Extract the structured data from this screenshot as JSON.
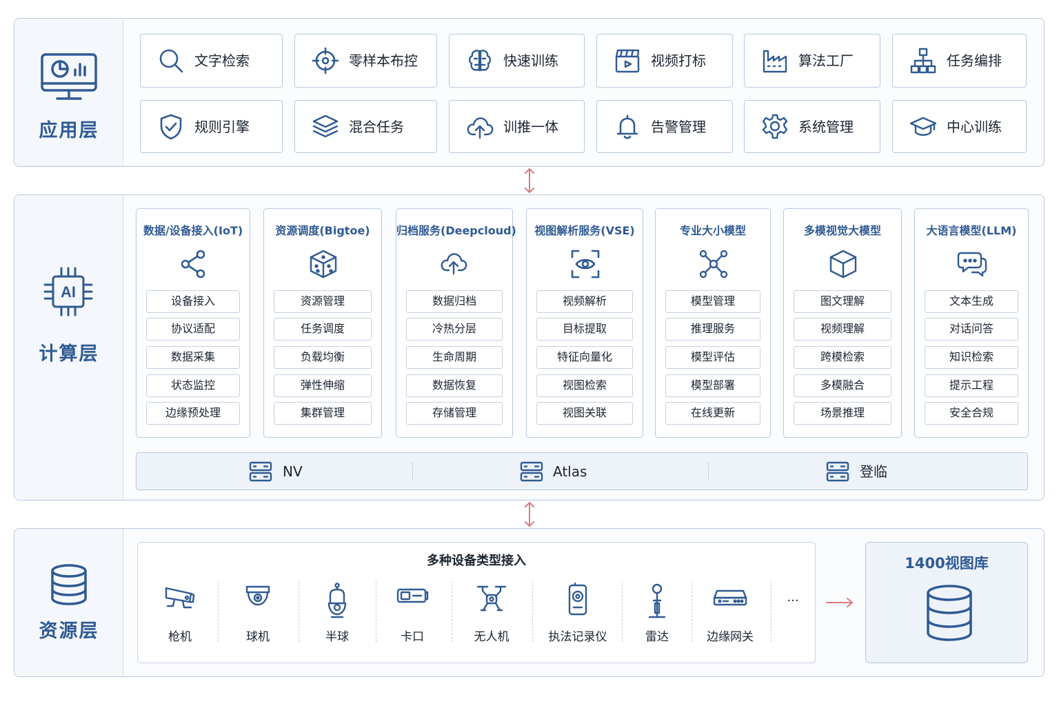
{
  "colors": {
    "accent": "#2f5a93",
    "border": "#b9c8dc",
    "arrow": "#d77a80"
  },
  "app_layer": {
    "title": "应用层",
    "icon": "monitor-chart-icon",
    "cards": [
      {
        "label": "文字检索",
        "icon": "search-icon"
      },
      {
        "label": "零样本布控",
        "icon": "crosshair-icon"
      },
      {
        "label": "快速训练",
        "icon": "brain-icon"
      },
      {
        "label": "视频打标",
        "icon": "clapperboard-icon"
      },
      {
        "label": "算法工厂",
        "icon": "factory-icon"
      },
      {
        "label": "任务编排",
        "icon": "hierarchy-icon"
      },
      {
        "label": "规则引擎",
        "icon": "shield-check-icon"
      },
      {
        "label": "混合任务",
        "icon": "layers-icon"
      },
      {
        "label": "训推一体",
        "icon": "cloud-upload-icon"
      },
      {
        "label": "告警管理",
        "icon": "bell-icon"
      },
      {
        "label": "系统管理",
        "icon": "gear-icon"
      },
      {
        "label": "中心训练",
        "icon": "graduation-cap-icon"
      }
    ]
  },
  "compute_layer": {
    "title": "计算层",
    "icon_text": "AI",
    "columns": [
      {
        "title": "数据/设备接入(IoT)",
        "icon": "share-icon",
        "items": [
          "设备接入",
          "协议适配",
          "数据采集",
          "状态监控",
          "边缘预处理"
        ]
      },
      {
        "title": "资源调度(Bigtoe)",
        "icon": "cube-dots-icon",
        "items": [
          "资源管理",
          "任务调度",
          "负载均衡",
          "弹性伸缩",
          "集群管理"
        ]
      },
      {
        "title": "归档服务(Deepcloud)",
        "icon": "cloud-upload-icon",
        "items": [
          "数据归档",
          "冷热分层",
          "生命周期",
          "数据恢复",
          "存储管理"
        ]
      },
      {
        "title": "视图解析服务(VSE)",
        "icon": "eye-scan-icon",
        "items": [
          "视频解析",
          "目标提取",
          "特征向量化",
          "视图检索",
          "视图关联"
        ]
      },
      {
        "title": "专业大小模型",
        "icon": "network-nodes-icon",
        "items": [
          "模型管理",
          "推理服务",
          "模型评估",
          "模型部署",
          "在线更新"
        ]
      },
      {
        "title": "多模视觉大模型",
        "icon": "cube-icon",
        "items": [
          "图文理解",
          "视频理解",
          "跨模检索",
          "多模融合",
          "场景推理"
        ]
      },
      {
        "title": "大语言模型(LLM)",
        "icon": "chat-bubbles-icon",
        "items": [
          "文本生成",
          "对话问答",
          "知识检索",
          "提示工程",
          "安全合规"
        ]
      }
    ],
    "hardware": [
      {
        "label": "NV",
        "icon": "server-icon"
      },
      {
        "label": "Atlas",
        "icon": "server-icon"
      },
      {
        "label": "登临",
        "icon": "server-icon"
      }
    ]
  },
  "resource_layer": {
    "title": "资源层",
    "icon": "database-icon",
    "devices_title": "多种设备类型接入",
    "devices": [
      {
        "label": "枪机",
        "icon": "bullet-camera-icon"
      },
      {
        "label": "球机",
        "icon": "dome-camera-icon"
      },
      {
        "label": "半球",
        "icon": "ptz-camera-icon"
      },
      {
        "label": "卡口",
        "icon": "checkpoint-camera-icon"
      },
      {
        "label": "无人机",
        "icon": "drone-icon"
      },
      {
        "label": "执法记录仪",
        "icon": "body-camera-icon"
      },
      {
        "label": "雷达",
        "icon": "radar-icon"
      },
      {
        "label": "边缘网关",
        "icon": "gateway-icon"
      }
    ],
    "more": "···",
    "library_title": "1400视图库",
    "library_icon": "database-icon"
  }
}
